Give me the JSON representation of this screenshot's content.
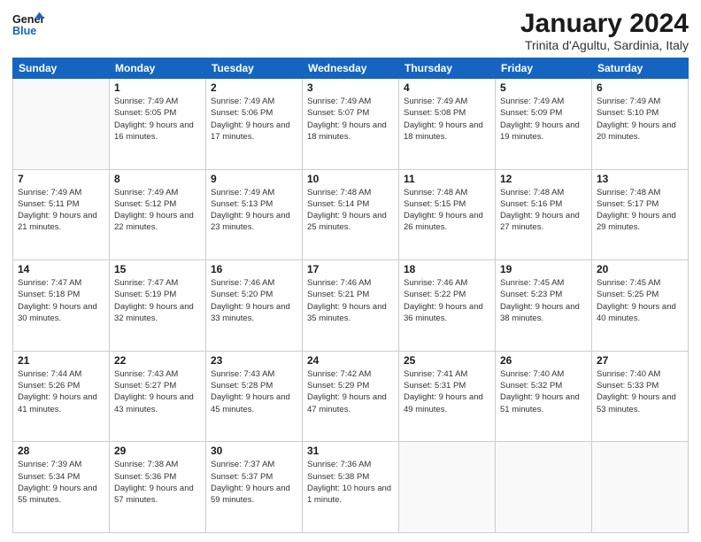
{
  "logo": {
    "text_general": "General",
    "text_blue": "Blue"
  },
  "title": "January 2024",
  "location": "Trinita d'Agultu, Sardinia, Italy",
  "days_of_week": [
    "Sunday",
    "Monday",
    "Tuesday",
    "Wednesday",
    "Thursday",
    "Friday",
    "Saturday"
  ],
  "weeks": [
    [
      {
        "day": "",
        "sunrise": "",
        "sunset": "",
        "daylight": ""
      },
      {
        "day": "1",
        "sunrise": "Sunrise: 7:49 AM",
        "sunset": "Sunset: 5:05 PM",
        "daylight": "Daylight: 9 hours and 16 minutes."
      },
      {
        "day": "2",
        "sunrise": "Sunrise: 7:49 AM",
        "sunset": "Sunset: 5:06 PM",
        "daylight": "Daylight: 9 hours and 17 minutes."
      },
      {
        "day": "3",
        "sunrise": "Sunrise: 7:49 AM",
        "sunset": "Sunset: 5:07 PM",
        "daylight": "Daylight: 9 hours and 18 minutes."
      },
      {
        "day": "4",
        "sunrise": "Sunrise: 7:49 AM",
        "sunset": "Sunset: 5:08 PM",
        "daylight": "Daylight: 9 hours and 18 minutes."
      },
      {
        "day": "5",
        "sunrise": "Sunrise: 7:49 AM",
        "sunset": "Sunset: 5:09 PM",
        "daylight": "Daylight: 9 hours and 19 minutes."
      },
      {
        "day": "6",
        "sunrise": "Sunrise: 7:49 AM",
        "sunset": "Sunset: 5:10 PM",
        "daylight": "Daylight: 9 hours and 20 minutes."
      }
    ],
    [
      {
        "day": "7",
        "sunrise": "Sunrise: 7:49 AM",
        "sunset": "Sunset: 5:11 PM",
        "daylight": "Daylight: 9 hours and 21 minutes."
      },
      {
        "day": "8",
        "sunrise": "Sunrise: 7:49 AM",
        "sunset": "Sunset: 5:12 PM",
        "daylight": "Daylight: 9 hours and 22 minutes."
      },
      {
        "day": "9",
        "sunrise": "Sunrise: 7:49 AM",
        "sunset": "Sunset: 5:13 PM",
        "daylight": "Daylight: 9 hours and 23 minutes."
      },
      {
        "day": "10",
        "sunrise": "Sunrise: 7:48 AM",
        "sunset": "Sunset: 5:14 PM",
        "daylight": "Daylight: 9 hours and 25 minutes."
      },
      {
        "day": "11",
        "sunrise": "Sunrise: 7:48 AM",
        "sunset": "Sunset: 5:15 PM",
        "daylight": "Daylight: 9 hours and 26 minutes."
      },
      {
        "day": "12",
        "sunrise": "Sunrise: 7:48 AM",
        "sunset": "Sunset: 5:16 PM",
        "daylight": "Daylight: 9 hours and 27 minutes."
      },
      {
        "day": "13",
        "sunrise": "Sunrise: 7:48 AM",
        "sunset": "Sunset: 5:17 PM",
        "daylight": "Daylight: 9 hours and 29 minutes."
      }
    ],
    [
      {
        "day": "14",
        "sunrise": "Sunrise: 7:47 AM",
        "sunset": "Sunset: 5:18 PM",
        "daylight": "Daylight: 9 hours and 30 minutes."
      },
      {
        "day": "15",
        "sunrise": "Sunrise: 7:47 AM",
        "sunset": "Sunset: 5:19 PM",
        "daylight": "Daylight: 9 hours and 32 minutes."
      },
      {
        "day": "16",
        "sunrise": "Sunrise: 7:46 AM",
        "sunset": "Sunset: 5:20 PM",
        "daylight": "Daylight: 9 hours and 33 minutes."
      },
      {
        "day": "17",
        "sunrise": "Sunrise: 7:46 AM",
        "sunset": "Sunset: 5:21 PM",
        "daylight": "Daylight: 9 hours and 35 minutes."
      },
      {
        "day": "18",
        "sunrise": "Sunrise: 7:46 AM",
        "sunset": "Sunset: 5:22 PM",
        "daylight": "Daylight: 9 hours and 36 minutes."
      },
      {
        "day": "19",
        "sunrise": "Sunrise: 7:45 AM",
        "sunset": "Sunset: 5:23 PM",
        "daylight": "Daylight: 9 hours and 38 minutes."
      },
      {
        "day": "20",
        "sunrise": "Sunrise: 7:45 AM",
        "sunset": "Sunset: 5:25 PM",
        "daylight": "Daylight: 9 hours and 40 minutes."
      }
    ],
    [
      {
        "day": "21",
        "sunrise": "Sunrise: 7:44 AM",
        "sunset": "Sunset: 5:26 PM",
        "daylight": "Daylight: 9 hours and 41 minutes."
      },
      {
        "day": "22",
        "sunrise": "Sunrise: 7:43 AM",
        "sunset": "Sunset: 5:27 PM",
        "daylight": "Daylight: 9 hours and 43 minutes."
      },
      {
        "day": "23",
        "sunrise": "Sunrise: 7:43 AM",
        "sunset": "Sunset: 5:28 PM",
        "daylight": "Daylight: 9 hours and 45 minutes."
      },
      {
        "day": "24",
        "sunrise": "Sunrise: 7:42 AM",
        "sunset": "Sunset: 5:29 PM",
        "daylight": "Daylight: 9 hours and 47 minutes."
      },
      {
        "day": "25",
        "sunrise": "Sunrise: 7:41 AM",
        "sunset": "Sunset: 5:31 PM",
        "daylight": "Daylight: 9 hours and 49 minutes."
      },
      {
        "day": "26",
        "sunrise": "Sunrise: 7:40 AM",
        "sunset": "Sunset: 5:32 PM",
        "daylight": "Daylight: 9 hours and 51 minutes."
      },
      {
        "day": "27",
        "sunrise": "Sunrise: 7:40 AM",
        "sunset": "Sunset: 5:33 PM",
        "daylight": "Daylight: 9 hours and 53 minutes."
      }
    ],
    [
      {
        "day": "28",
        "sunrise": "Sunrise: 7:39 AM",
        "sunset": "Sunset: 5:34 PM",
        "daylight": "Daylight: 9 hours and 55 minutes."
      },
      {
        "day": "29",
        "sunrise": "Sunrise: 7:38 AM",
        "sunset": "Sunset: 5:36 PM",
        "daylight": "Daylight: 9 hours and 57 minutes."
      },
      {
        "day": "30",
        "sunrise": "Sunrise: 7:37 AM",
        "sunset": "Sunset: 5:37 PM",
        "daylight": "Daylight: 9 hours and 59 minutes."
      },
      {
        "day": "31",
        "sunrise": "Sunrise: 7:36 AM",
        "sunset": "Sunset: 5:38 PM",
        "daylight": "Daylight: 10 hours and 1 minute."
      },
      {
        "day": "",
        "sunrise": "",
        "sunset": "",
        "daylight": ""
      },
      {
        "day": "",
        "sunrise": "",
        "sunset": "",
        "daylight": ""
      },
      {
        "day": "",
        "sunrise": "",
        "sunset": "",
        "daylight": ""
      }
    ]
  ]
}
